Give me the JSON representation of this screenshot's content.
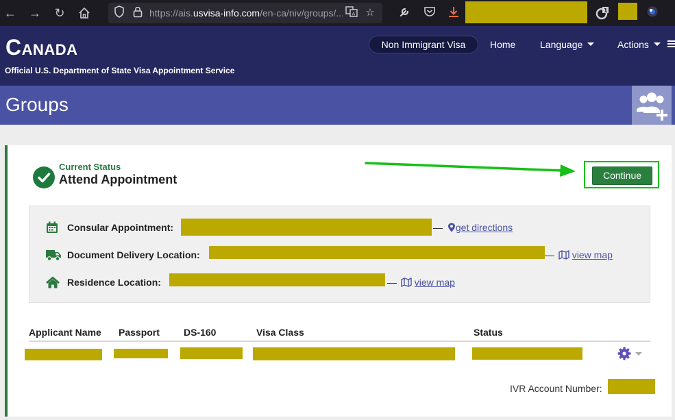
{
  "browser": {
    "url_host": "https://ais.",
    "url_domain": "usvisa-info.com",
    "url_path": "/en-ca/niv/groups/...",
    "extension_badge": "1",
    "icons": [
      "back-icon",
      "forward-icon",
      "reload-icon",
      "home-icon",
      "shield-icon",
      "lock-icon",
      "translate-icon",
      "bookmark-star-icon",
      "wrench-icon",
      "pocket-icon",
      "download-icon",
      "extension-icon",
      "profile-icon",
      "firefox-menu-icon"
    ]
  },
  "header": {
    "brand": "Canada",
    "subtitle": "Official U.S. Department of State Visa Appointment Service",
    "nav": {
      "visa_type": "Non Immigrant Visa",
      "home": "Home",
      "language": "Language",
      "actions": "Actions"
    }
  },
  "page": {
    "title": "Groups"
  },
  "status": {
    "label": "Current Status",
    "value": "Attend Appointment",
    "continue": "Continue"
  },
  "info": {
    "consular_label": "Consular Appointment:",
    "consular_link": "get directions",
    "delivery_label": "Document Delivery Location:",
    "delivery_link": "view map",
    "residence_label": "Residence Location:",
    "residence_link": "view map",
    "dash": "—"
  },
  "table": {
    "headers": [
      "Applicant Name",
      "Passport",
      "DS-160",
      "Visa Class",
      "Status"
    ]
  },
  "ivr": {
    "label": "IVR Account Number:"
  },
  "colors": {
    "header_bg": "#25285f",
    "titlebar_bg": "#4a52a3",
    "accent_green": "#2a7a3f",
    "continue_highlight": "#16c016",
    "redaction": "#bba900",
    "link": "#4a52a3"
  }
}
